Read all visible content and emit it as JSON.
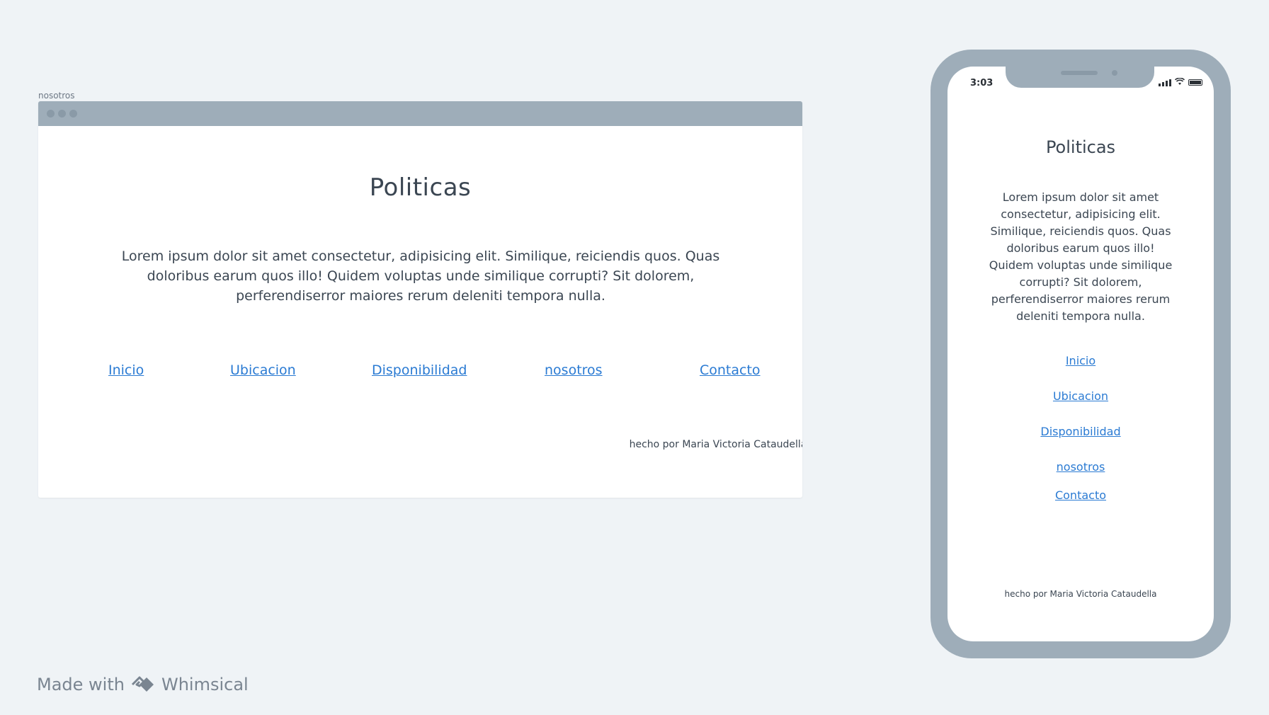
{
  "browser": {
    "frame_label": "nosotros",
    "title": "Politicas",
    "paragraph": "Lorem ipsum dolor sit amet consectetur, adipisicing elit. Similique, reiciendis quos. Quas doloribus earum quos illo! Quidem voluptas unde similique corrupti? Sit dolorem, perferendiserror maiores rerum deleniti tempora nulla.",
    "nav": [
      "Inicio",
      "Ubicacion",
      "Disponibilidad",
      "nosotros",
      "Contacto"
    ],
    "footer": "hecho por Maria Victoria Cataudella"
  },
  "phone": {
    "time": "3:03",
    "title": "Politicas",
    "paragraph": "Lorem ipsum dolor sit amet consectetur, adipisicing elit. Similique, reiciendis quos. Quas doloribus earum quos illo! Quidem voluptas unde similique corrupti? Sit dolorem, perferendiserror maiores rerum deleniti tempora nulla.",
    "nav": [
      "Inicio",
      "Ubicacion",
      "Disponibilidad",
      "nosotros",
      "Contacto"
    ],
    "footer": "hecho por Maria Victoria Cataudella"
  },
  "branding": {
    "made_with": "Made with",
    "brand": "Whimsical"
  },
  "colors": {
    "background": "#eff3f6",
    "frame": "#9eadb9",
    "link": "#2b7bd3",
    "text": "#3b4652"
  }
}
